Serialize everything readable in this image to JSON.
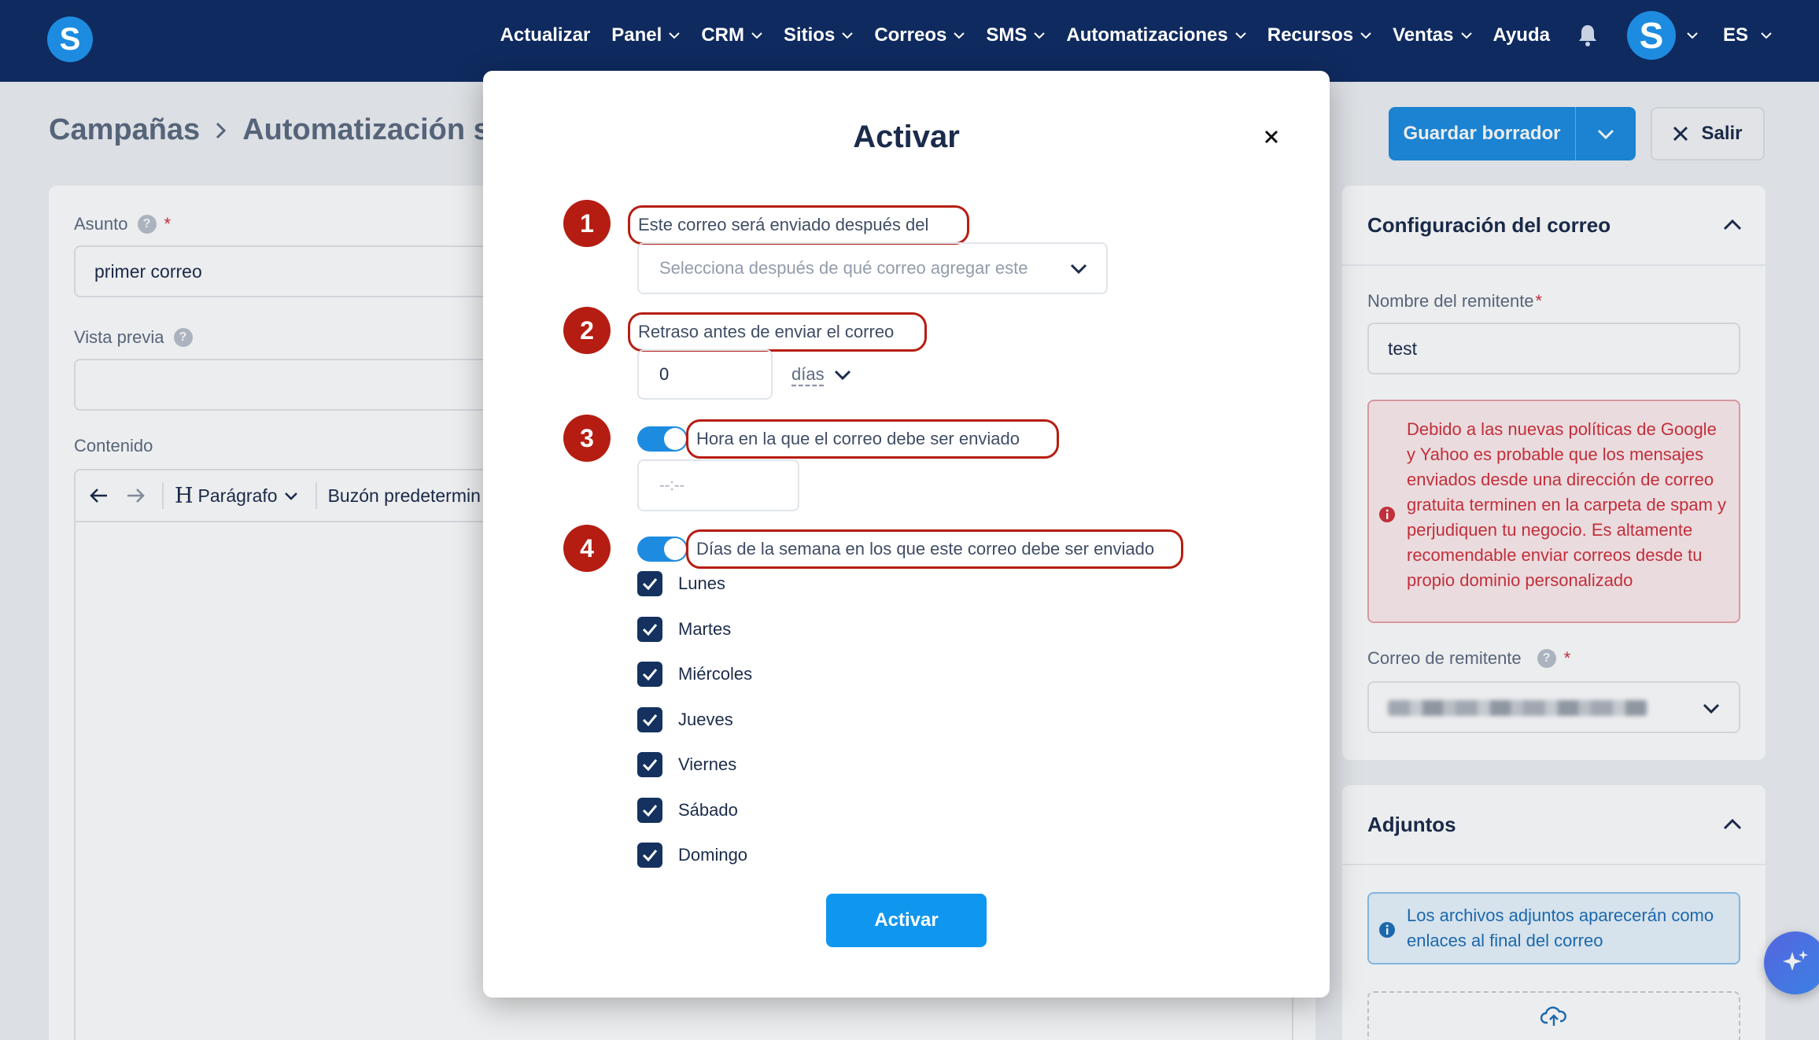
{
  "app": {
    "logo_letter": "S"
  },
  "nav": {
    "items": [
      {
        "label": "Actualizar",
        "dropdown": false
      },
      {
        "label": "Panel",
        "dropdown": true
      },
      {
        "label": "CRM",
        "dropdown": true
      },
      {
        "label": "Sitios",
        "dropdown": true
      },
      {
        "label": "Correos",
        "dropdown": true
      },
      {
        "label": "SMS",
        "dropdown": true
      },
      {
        "label": "Automatizaciones",
        "dropdown": true
      },
      {
        "label": "Recursos",
        "dropdown": true
      },
      {
        "label": "Ventas",
        "dropdown": true
      },
      {
        "label": "Ayuda",
        "dropdown": false
      }
    ],
    "avatar_letter": "S",
    "language": "ES"
  },
  "breadcrumb": {
    "root": "Campañas",
    "current": "Automatización se"
  },
  "header_actions": {
    "save_draft": "Guardar borrador",
    "exit": "Salir"
  },
  "editor": {
    "subject_label": "Asunto",
    "subject_value": "primer correo",
    "preview_label": "Vista previa",
    "preview_value": "",
    "content_label": "Contenido",
    "toolbar": {
      "heading_letter": "H",
      "paragraph": "Parágrafo",
      "mailbox": "Buzón predetermin"
    }
  },
  "email_config": {
    "title": "Configuración del correo",
    "sender_name_label": "Nombre del remitente",
    "sender_name_value": "test",
    "warning": "Debido a las nuevas políticas de Google y Yahoo es probable que los mensajes enviados desde una dirección de correo gratuita terminen en la carpeta de spam y perjudiquen tu negocio. Es altamente recomendable enviar correos desde tu propio dominio personalizado",
    "sender_email_label": "Correo de remitente"
  },
  "attachments": {
    "title": "Adjuntos",
    "info": "Los archivos adjuntos aparecerán como enlaces al final del correo"
  },
  "modal": {
    "title": "Activar",
    "step_numbers": [
      "1",
      "2",
      "3",
      "4"
    ],
    "after_label": "Este correo será enviado después del",
    "after_placeholder": "Selecciona después de qué correo agregar este",
    "delay_label": "Retraso antes de enviar el correo",
    "delay_value": "0",
    "delay_unit": "días",
    "time_label": "Hora en la que el correo debe ser enviado",
    "time_placeholder": "--:--",
    "time_enabled": true,
    "weekdays_label": "Días de la semana en los que este correo debe ser enviado",
    "weekdays_enabled": true,
    "days": [
      {
        "label": "Lunes",
        "checked": true
      },
      {
        "label": "Martes",
        "checked": true
      },
      {
        "label": "Miércoles",
        "checked": true
      },
      {
        "label": "Jueves",
        "checked": true
      },
      {
        "label": "Viernes",
        "checked": true
      },
      {
        "label": "Sábado",
        "checked": true
      },
      {
        "label": "Domingo",
        "checked": true
      }
    ],
    "submit": "Activar"
  },
  "colors": {
    "nav_bg": "#0f2a5f",
    "primary": "#1d8ce0",
    "annotation_red": "#b51d12",
    "checkbox": "#14315f",
    "warning_red": "#d1313d"
  }
}
